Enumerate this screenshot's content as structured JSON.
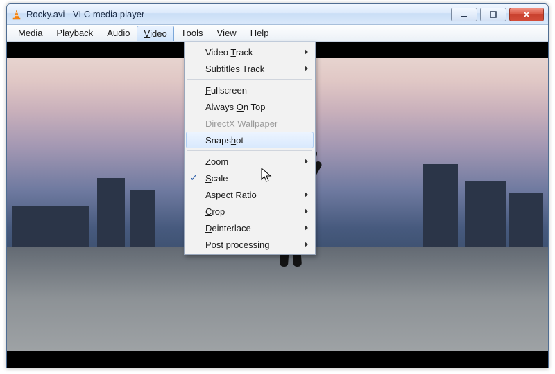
{
  "window": {
    "title": "Rocky.avi - VLC media player",
    "app_icon": "vlc-cone-icon"
  },
  "controls": {
    "minimize": "minimize",
    "maximize": "maximize",
    "close": "close"
  },
  "menubar": {
    "items": [
      {
        "label": "Media",
        "hotkey_index": 0
      },
      {
        "label": "Playback",
        "hotkey_index": 4
      },
      {
        "label": "Audio",
        "hotkey_index": 0
      },
      {
        "label": "Video",
        "hotkey_index": 0,
        "open": true
      },
      {
        "label": "Tools",
        "hotkey_index": 0
      },
      {
        "label": "View",
        "hotkey_index": 1
      },
      {
        "label": "Help",
        "hotkey_index": 0
      }
    ]
  },
  "video_menu": {
    "groups": [
      [
        {
          "label": "Video Track",
          "hotkey_index": 6,
          "submenu": true
        },
        {
          "label": "Subtitles Track",
          "hotkey_index": 0,
          "submenu": true
        }
      ],
      [
        {
          "label": "Fullscreen",
          "hotkey_index": 0
        },
        {
          "label": "Always On Top",
          "hotkey_index": 7
        },
        {
          "label": "DirectX Wallpaper",
          "disabled": true
        },
        {
          "label": "Snapshot",
          "hotkey_index": 5,
          "hover": true
        }
      ],
      [
        {
          "label": "Zoom",
          "hotkey_index": 0,
          "submenu": true
        },
        {
          "label": "Scale",
          "hotkey_index": 0,
          "checked": true
        },
        {
          "label": "Aspect Ratio",
          "hotkey_index": 0,
          "submenu": true
        },
        {
          "label": "Crop",
          "hotkey_index": 0,
          "submenu": true
        },
        {
          "label": "Deinterlace",
          "hotkey_index": 0,
          "submenu": true
        },
        {
          "label": "Post processing",
          "hotkey_index": 0,
          "submenu": true
        }
      ]
    ]
  }
}
